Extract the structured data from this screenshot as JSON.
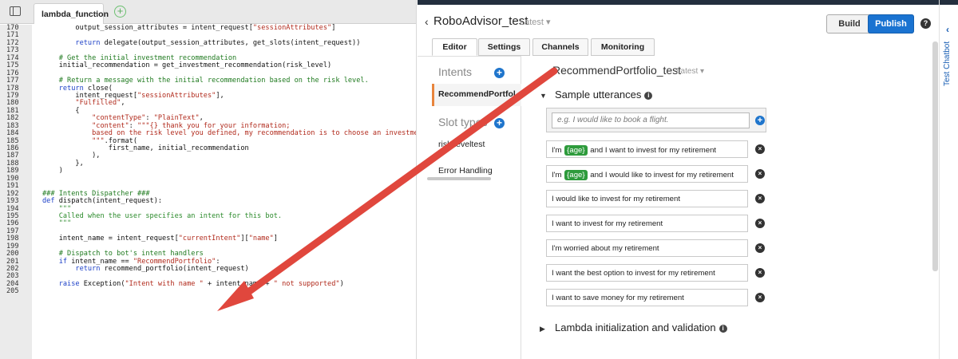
{
  "editor": {
    "tab_label": "lambda_function",
    "tab_close": "×",
    "add_tab": "+",
    "lines": [
      {
        "n": "170",
        "segs": [
          [
            "        output_session_attributes = intent_request[",
            ""
          ],
          [
            "\"sessionAttributes\"",
            "st"
          ],
          [
            "]",
            ""
          ]
        ]
      },
      {
        "n": "171",
        "segs": []
      },
      {
        "n": "172",
        "segs": [
          [
            "        ",
            ""
          ],
          [
            "return",
            "kw"
          ],
          [
            " delegate(output_session_attributes, get_slots(intent_request))",
            ""
          ]
        ]
      },
      {
        "n": "173",
        "segs": []
      },
      {
        "n": "174",
        "segs": [
          [
            "    ",
            ""
          ],
          [
            "# Get the initial investment recommendation",
            "cm"
          ]
        ]
      },
      {
        "n": "175",
        "segs": [
          [
            "    initial_recommendation = get_investment_recommendation(risk_level)",
            ""
          ]
        ]
      },
      {
        "n": "176",
        "segs": []
      },
      {
        "n": "177",
        "segs": [
          [
            "    ",
            ""
          ],
          [
            "# Return a message with the initial recommendation based on the risk level.",
            "cm"
          ]
        ]
      },
      {
        "n": "178",
        "segs": [
          [
            "    ",
            ""
          ],
          [
            "return",
            "kw"
          ],
          [
            " close(",
            ""
          ]
        ]
      },
      {
        "n": "179",
        "segs": [
          [
            "        intent_request[",
            ""
          ],
          [
            "\"sessionAttributes\"",
            "st"
          ],
          [
            "],",
            ""
          ]
        ]
      },
      {
        "n": "180",
        "segs": [
          [
            "        ",
            ""
          ],
          [
            "\"Fulfilled\"",
            "st"
          ],
          [
            ",",
            ""
          ]
        ]
      },
      {
        "n": "181",
        "segs": [
          [
            "        {",
            ""
          ]
        ]
      },
      {
        "n": "182",
        "segs": [
          [
            "            ",
            ""
          ],
          [
            "\"contentType\"",
            "st"
          ],
          [
            ": ",
            ""
          ],
          [
            "\"PlainText\"",
            "st"
          ],
          [
            ",",
            ""
          ]
        ]
      },
      {
        "n": "183",
        "segs": [
          [
            "            ",
            ""
          ],
          [
            "\"content\"",
            "st"
          ],
          [
            ": ",
            ""
          ],
          [
            "\"\"\"{} thank you for your information;",
            "st"
          ]
        ]
      },
      {
        "n": "184",
        "segs": [
          [
            "            ",
            ""
          ],
          [
            "based on the risk level you defined, my recommendation is to choose an investment",
            "st"
          ]
        ]
      },
      {
        "n": "185",
        "segs": [
          [
            "            ",
            ""
          ],
          [
            "\"\"\"",
            "st"
          ],
          [
            ".format(",
            ""
          ]
        ]
      },
      {
        "n": "186",
        "segs": [
          [
            "                first_name, initial_recommendation",
            ""
          ]
        ]
      },
      {
        "n": "187",
        "segs": [
          [
            "            ),",
            ""
          ]
        ]
      },
      {
        "n": "188",
        "segs": [
          [
            "        },",
            ""
          ]
        ]
      },
      {
        "n": "189",
        "segs": [
          [
            "    )",
            ""
          ]
        ]
      },
      {
        "n": "190",
        "segs": []
      },
      {
        "n": "191",
        "segs": []
      },
      {
        "n": "192",
        "segs": [
          [
            "### Intents Dispatcher ###",
            "cm"
          ]
        ]
      },
      {
        "n": "193",
        "segs": [
          [
            "def",
            "kw"
          ],
          [
            " dispatch(intent_request):",
            ""
          ]
        ]
      },
      {
        "n": "194",
        "segs": [
          [
            "    ",
            ""
          ],
          [
            "\"\"\"",
            "st2"
          ]
        ]
      },
      {
        "n": "195",
        "segs": [
          [
            "    ",
            ""
          ],
          [
            "Called when the user specifies an intent for this bot.",
            "st2"
          ]
        ]
      },
      {
        "n": "196",
        "segs": [
          [
            "    ",
            ""
          ],
          [
            "\"\"\"",
            "st2"
          ]
        ]
      },
      {
        "n": "197",
        "segs": []
      },
      {
        "n": "198",
        "segs": [
          [
            "    intent_name = intent_request[",
            ""
          ],
          [
            "\"currentIntent\"",
            "st"
          ],
          [
            "][",
            ""
          ],
          [
            "\"name\"",
            "st"
          ],
          [
            "]",
            ""
          ]
        ]
      },
      {
        "n": "199",
        "segs": []
      },
      {
        "n": "200",
        "segs": [
          [
            "    ",
            ""
          ],
          [
            "# Dispatch to bot's intent handlers",
            "cm"
          ]
        ]
      },
      {
        "n": "201",
        "segs": [
          [
            "    ",
            ""
          ],
          [
            "if",
            "kw"
          ],
          [
            " intent_name == ",
            ""
          ],
          [
            "\"RecommendPortfolio\"",
            "st"
          ],
          [
            ":",
            ""
          ]
        ]
      },
      {
        "n": "202",
        "segs": [
          [
            "        ",
            ""
          ],
          [
            "return",
            "kw"
          ],
          [
            " recommend_portfolio(intent_request)",
            ""
          ]
        ]
      },
      {
        "n": "203",
        "segs": []
      },
      {
        "n": "204",
        "segs": [
          [
            "    ",
            ""
          ],
          [
            "raise",
            "kw"
          ],
          [
            " Exception(",
            ""
          ],
          [
            "\"Intent with name \"",
            "st"
          ],
          [
            " + intent_name + ",
            ""
          ],
          [
            "\" not supported\"",
            "st"
          ],
          [
            ")",
            ""
          ]
        ]
      },
      {
        "n": "205",
        "segs": []
      }
    ]
  },
  "console": {
    "back": "‹",
    "bot_name": "RoboAdvisor_test",
    "version": "Latest ▾",
    "build": "Build",
    "publish": "Publish",
    "help": "?",
    "tabs": [
      "Editor",
      "Settings",
      "Channels",
      "Monitoring"
    ],
    "nav": {
      "intents": "Intents",
      "intent_item": "RecommendPortfol",
      "slot_types": "Slot types",
      "slot_item": "riskLeveltest",
      "error_handling": "Error Handling",
      "plus": "+"
    },
    "intent": {
      "title": "RecommendPortfolio_test",
      "version": "Latest ▾"
    },
    "sample_utterances": {
      "heading": "Sample utterances",
      "placeholder": "e.g. I would like to book a flight.",
      "items": [
        {
          "pre": "I'm ",
          "slot": "{age}",
          "post": " and I want to invest for my retirement"
        },
        {
          "pre": "I'm ",
          "slot": "{age}",
          "post": " and I would like to invest for my retirement"
        },
        {
          "pre": "I would like to invest for my retirement",
          "slot": "",
          "post": ""
        },
        {
          "pre": "I want to invest for my retirement",
          "slot": "",
          "post": ""
        },
        {
          "pre": "I'm worried about my retirement",
          "slot": "",
          "post": ""
        },
        {
          "pre": "I want the best option to invest for my retirement",
          "slot": "",
          "post": ""
        },
        {
          "pre": "I want to save money for my retirement",
          "slot": "",
          "post": ""
        }
      ]
    },
    "lambda_section": "Lambda initialization and validation",
    "test_chatbot": "Test Chatbot",
    "rail_chevron": "‹"
  },
  "colors": {
    "publish": "#1a73d1",
    "active_nav_accent": "#e8853d",
    "slot_chip": "#2e9b3c",
    "arrow": "#e0473d"
  }
}
